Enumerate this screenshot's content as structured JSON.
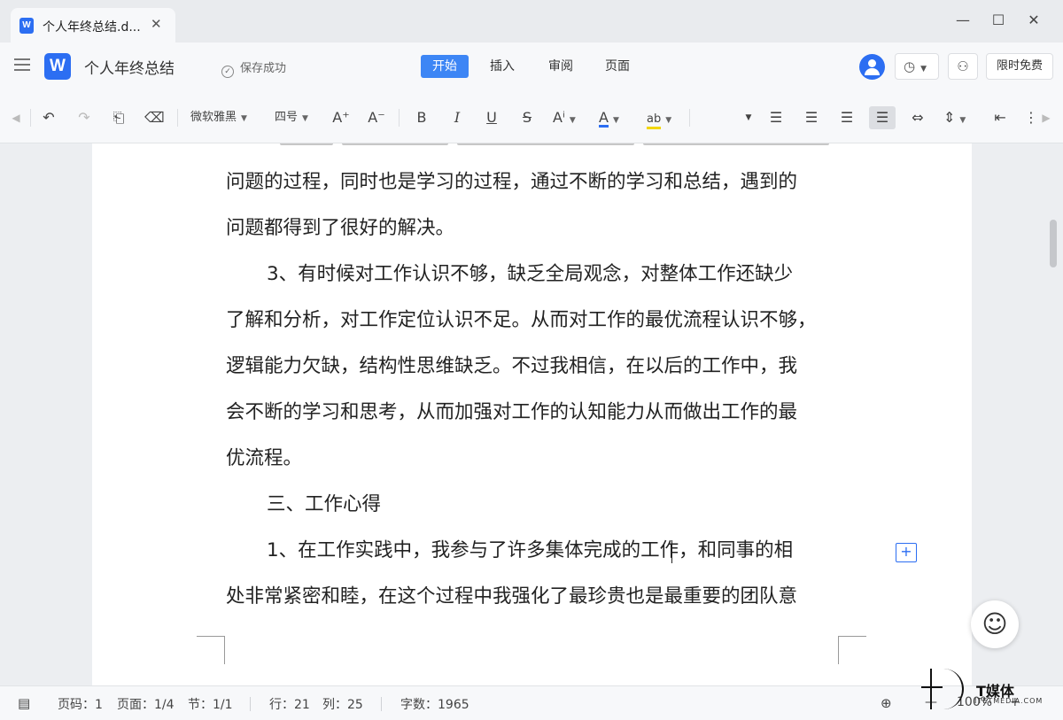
{
  "window": {
    "tab_title": "个人年终总结.d...",
    "tab_icon": "W",
    "tab_close": "✕",
    "minimize": "—",
    "maximize": "☐",
    "close": "✕"
  },
  "menubar": {
    "logo": "W",
    "doc_name": "个人年终总结",
    "save_status": "保存成功",
    "tabs": [
      {
        "label": "开始",
        "active": true
      },
      {
        "label": "插入",
        "active": false
      },
      {
        "label": "审阅",
        "active": false
      },
      {
        "label": "页面",
        "active": false
      }
    ],
    "free_label": "限时免费"
  },
  "toolbar": {
    "font_name": "微软雅黑",
    "font_size": "四号",
    "grow_font": "A⁺",
    "shrink_font": "A⁻",
    "bold": "B",
    "italic": "I",
    "underline": "U",
    "strike": "S",
    "superscript": "Aⁱ",
    "font_color": "A",
    "highlight": "ab"
  },
  "document": {
    "lines": [
      "问题的过程，同时也是学习的过程，通过不断的学习和总结，遇到的",
      "问题都得到了很好的解决。",
      "3、有时候对工作认识不够，缺乏全局观念，对整体工作还缺少",
      "了解和分析，对工作定位认识不足。从而对工作的最优流程认识不够，",
      "逻辑能力欠缺，结构性思维缺乏。不过我相信，在以后的工作中，我",
      "会不断的学习和思考，从而加强对工作的认知能力从而做出工作的最",
      "优流程。",
      "三、工作心得",
      "1、在工作实践中，我参与了许多集体完成的工作，和同事的相",
      "处非常紧密和睦，在这个过程中我强化了最珍贵也是最重要的团队意"
    ]
  },
  "statusbar": {
    "page_code": "页码：1",
    "page": "页面：1/4",
    "section": "节：1/1",
    "row": "行：21",
    "col": "列：25",
    "word_count": "字数：1965",
    "zoom": "100%",
    "zoom_out": "—",
    "zoom_in": "+"
  },
  "watermark": {
    "name": "T媒体",
    "sub": "ITETMEDIA.COM"
  },
  "colors": {
    "accent": "#3d86f5",
    "brand": "#2c6ef2"
  }
}
